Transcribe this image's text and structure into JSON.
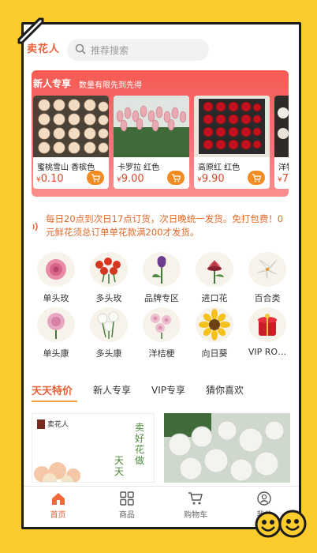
{
  "header": {
    "logo_text": "卖花人",
    "search_placeholder": "推荐搜索"
  },
  "new_user": {
    "title": "新人专享",
    "subtitle": "数量有限先到先得",
    "products": [
      {
        "name": "蜜桃雪山 香槟色",
        "currency": "¥",
        "price": "0.10"
      },
      {
        "name": "卡罗拉 红色",
        "currency": "¥",
        "price": "9.00"
      },
      {
        "name": "高原红 红色",
        "currency": "¥",
        "price": "9.90"
      },
      {
        "name": "洋牡",
        "currency": "¥",
        "price": "7"
      }
    ]
  },
  "notice": {
    "text": "每日20点到次日17点订货，次日晚统一发货。免打包费！0元鲜花须总订单单花款满200才发货。"
  },
  "categories_row1": [
    {
      "label": "单头玫",
      "icon": "rose-pink-icon"
    },
    {
      "label": "多头玫",
      "icon": "rose-spray-icon"
    },
    {
      "label": "品牌专区",
      "icon": "tulip-icon"
    },
    {
      "label": "进口花",
      "icon": "protea-icon"
    },
    {
      "label": "百合类",
      "icon": "lily-icon"
    }
  ],
  "categories_row2": [
    {
      "label": "单头康",
      "icon": "carnation-icon"
    },
    {
      "label": "多头康",
      "icon": "spray-carnation-icon"
    },
    {
      "label": "洋桔梗",
      "icon": "eustoma-icon"
    },
    {
      "label": "向日葵",
      "icon": "sunflower-icon"
    },
    {
      "label": "VIP RO…",
      "icon": "vip-rose-box-icon"
    }
  ],
  "tabs": [
    {
      "label": "天天特价",
      "active": true
    },
    {
      "label": "新人专享",
      "active": false
    },
    {
      "label": "VIP专享",
      "active": false
    },
    {
      "label": "猜你喜欢",
      "active": false
    }
  ],
  "promo": {
    "logo_text": "卖花人",
    "slogan_a": "卖好花",
    "slogan_b": "做",
    "slogan_c": "天天"
  },
  "bottom_nav": [
    {
      "label": "首页",
      "icon": "home-icon",
      "active": true
    },
    {
      "label": "商品",
      "icon": "grid-icon",
      "active": false
    },
    {
      "label": "购物车",
      "icon": "cart-icon",
      "active": false
    },
    {
      "label": "我的",
      "icon": "user-icon",
      "active": false
    }
  ],
  "colors": {
    "accent": "#E5623A",
    "background": "#FCCB2C",
    "banner": "#F45B52",
    "notice_text": "#E06A2A"
  }
}
